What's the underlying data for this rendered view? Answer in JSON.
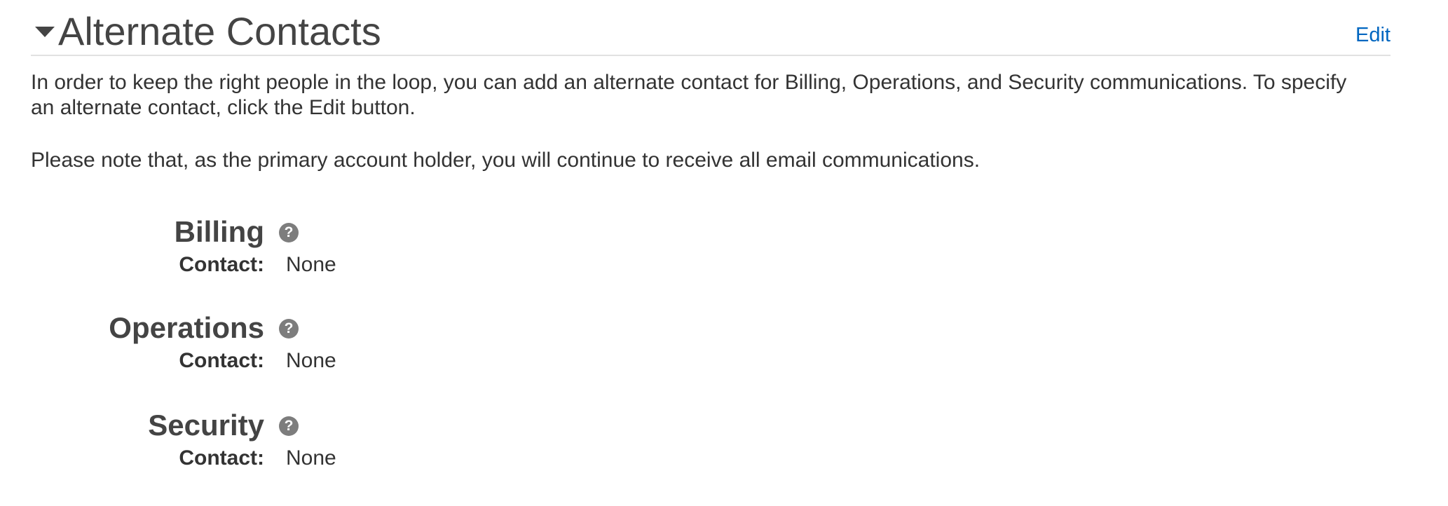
{
  "section": {
    "title": "Alternate Contacts",
    "edit_label": "Edit",
    "description": "In order to keep the right people in the loop, you can add an alternate contact for Billing, Operations, and Security communications. To specify an alternate contact, click the Edit button.",
    "note": "Please note that, as the primary account holder, you will continue to receive all email communications."
  },
  "contacts": [
    {
      "name": "Billing",
      "contact_label": "Contact:",
      "contact_value": "None",
      "help_icon": "question-circle-icon"
    },
    {
      "name": "Operations",
      "contact_label": "Contact:",
      "contact_value": "None",
      "help_icon": "question-circle-icon"
    },
    {
      "name": "Security",
      "contact_label": "Contact:",
      "contact_value": "None",
      "help_icon": "question-circle-icon"
    }
  ],
  "colors": {
    "link": "#0066c0",
    "heading": "#444444",
    "text": "#333333",
    "divider": "#e1e1e1",
    "help_icon": "#7d7d7d"
  }
}
